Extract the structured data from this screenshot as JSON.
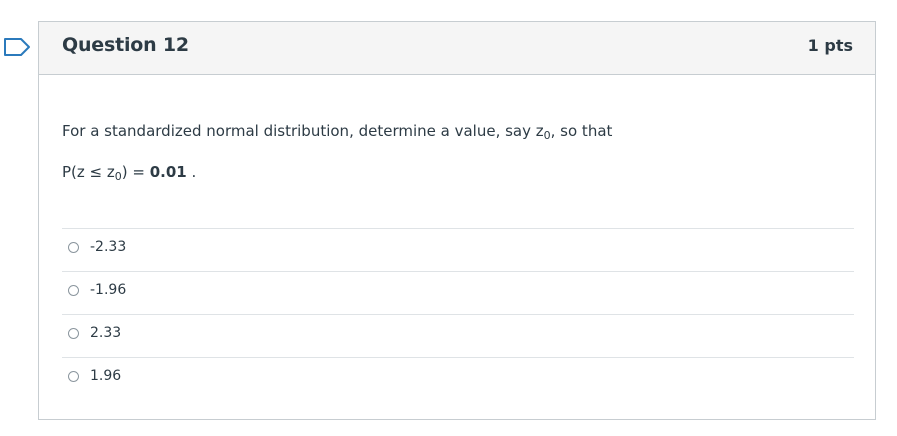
{
  "question": {
    "title": "Question 12",
    "points": "1 pts",
    "text_before": "For a standardized normal distribution, determine a value, say z",
    "text_sub": "0",
    "text_after": ", so that",
    "expr_prefix": "P(z ≤ z",
    "expr_sub": "0",
    "expr_suffix": ") = ",
    "expr_value": "0.01",
    "expr_end": " ."
  },
  "answers": [
    {
      "label": "-2.33"
    },
    {
      "label": "-1.96"
    },
    {
      "label": "2.33"
    },
    {
      "label": "1.96"
    }
  ],
  "colors": {
    "flag": "#2b7abc",
    "border": "#c7cdd1",
    "header_bg": "#f5f5f5",
    "text": "#2d3b45"
  }
}
